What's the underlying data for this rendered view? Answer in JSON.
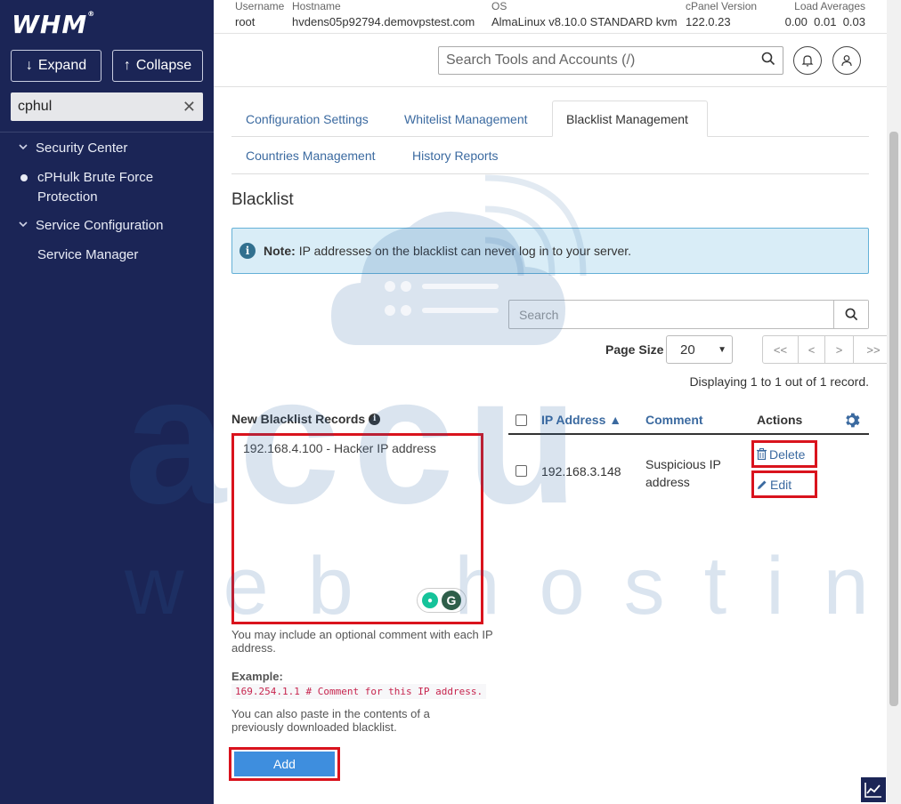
{
  "brand": {
    "logo": "WHM",
    "logo_mark": "®"
  },
  "sidebar": {
    "expand_label": "Expand",
    "collapse_label": "Collapse",
    "search_value": "cphul",
    "items": [
      {
        "label": "Security Center",
        "type": "section"
      },
      {
        "label": "cPHulk Brute Force Protection",
        "type": "active"
      },
      {
        "label": "Service Configuration",
        "type": "section"
      },
      {
        "label": "Service Manager",
        "type": "sub"
      }
    ]
  },
  "header": {
    "username_label": "Username",
    "username": "root",
    "hostname_label": "Hostname",
    "hostname": "hvdens05p92794.demovpstest.com",
    "os_label": "OS",
    "os": "AlmaLinux v8.10.0 STANDARD kvm",
    "cpanel_label": "cPanel Version",
    "cpanel": "122.0.23",
    "load_label": "Load Averages",
    "load1": "0.00",
    "load5": "0.01",
    "load15": "0.03",
    "search_placeholder": "Search Tools and Accounts (/)"
  },
  "tabs": [
    {
      "label": "Configuration Settings"
    },
    {
      "label": "Whitelist Management"
    },
    {
      "label": "Blacklist Management",
      "active": true
    },
    {
      "label": "Countries Management"
    },
    {
      "label": "History Reports"
    }
  ],
  "page": {
    "title": "Blacklist",
    "note_bold": "Note:",
    "note_text": "IP addresses on the blacklist can never log in to your server."
  },
  "new_records": {
    "label": "New Blacklist Records",
    "textarea_value": "192.168.4.100 - Hacker IP address",
    "help1": "You may include an optional comment with each IP address.",
    "example_label": "Example:",
    "example_code": "169.254.1.1 # Comment for this IP address.",
    "help2": "You can also paste in the contents of a previously downloaded blacklist.",
    "add_label": "Add"
  },
  "list": {
    "search_placeholder": "Search",
    "page_size_label": "Page Size",
    "page_size_value": "20",
    "pager": [
      "<<",
      "<",
      ">",
      ">>"
    ],
    "display_text": "Displaying 1 to 1 out of 1 record.",
    "columns": {
      "ip": "IP Address ▲",
      "comment": "Comment",
      "actions": "Actions"
    },
    "rows": [
      {
        "ip": "192.168.3.148",
        "comment": "Suspicious IP address",
        "delete": "Delete",
        "edit": "Edit"
      }
    ]
  },
  "watermark": {
    "line1": "accu",
    "line2": "web hosting"
  },
  "colors": {
    "sidebar": "#1b2556",
    "link": "#3b6aa0",
    "highlight": "#d9131d",
    "note_bg": "#d9edf7",
    "primary": "#3e8ede"
  }
}
